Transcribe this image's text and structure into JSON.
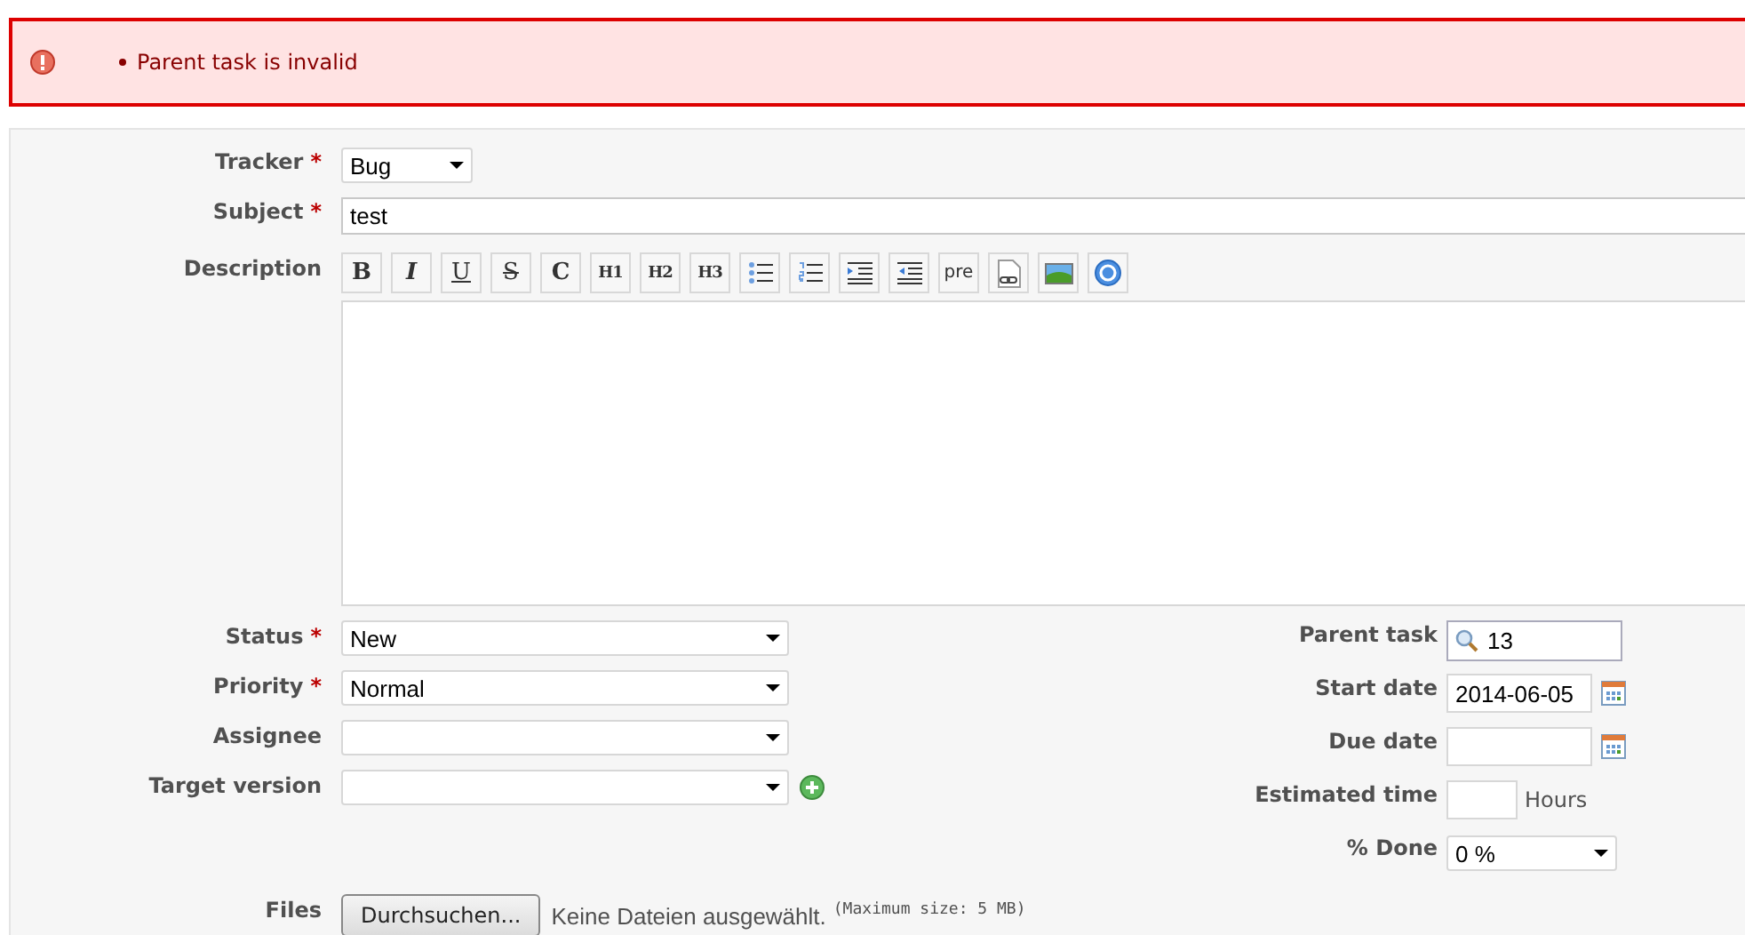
{
  "errors": {
    "messages": [
      "Parent task is invalid"
    ]
  },
  "tracker": {
    "label": "Tracker",
    "required_mark": "*",
    "value": "Bug"
  },
  "subject": {
    "label": "Subject",
    "required_mark": "*",
    "value": "test"
  },
  "description": {
    "label": "Description",
    "toolbar": [
      {
        "kind": "text",
        "label": "B"
      },
      {
        "kind": "text",
        "label": "I"
      },
      {
        "kind": "text",
        "label": "U"
      },
      {
        "kind": "text",
        "label": "S"
      },
      {
        "kind": "text",
        "label": "C"
      },
      {
        "kind": "text",
        "label": "H1"
      },
      {
        "kind": "text",
        "label": "H2"
      },
      {
        "kind": "text",
        "label": "H3"
      },
      {
        "kind": "icon"
      },
      {
        "kind": "icon"
      },
      {
        "kind": "icon"
      },
      {
        "kind": "icon"
      },
      {
        "kind": "text",
        "label": "pre"
      },
      {
        "kind": "icon"
      },
      {
        "kind": "icon"
      },
      {
        "kind": "icon"
      }
    ]
  },
  "left_fields": [
    {
      "label": "Status",
      "required_mark": "*",
      "value": "New",
      "add_button": false
    },
    {
      "label": "Priority",
      "required_mark": "*",
      "value": "Normal",
      "add_button": false
    },
    {
      "label": "Assignee",
      "add_button": false
    },
    {
      "label": "Target version",
      "add_button": true
    }
  ],
  "right_fields": [
    {
      "kind": "search",
      "label": "Parent task",
      "value": "13"
    },
    {
      "kind": "date",
      "label": "Start date",
      "value": "2014-06-05"
    },
    {
      "kind": "date",
      "label": "Due date"
    },
    {
      "kind": "hours",
      "label": "Estimated time",
      "unit": "Hours"
    },
    {
      "kind": "select",
      "label": "% Done",
      "value": "0 %"
    }
  ],
  "files": {
    "label": "Files",
    "button": "Durchsuchen...",
    "status": "Keine Dateien ausgewählt.",
    "note": "(Maximum size: 5 MB)"
  }
}
